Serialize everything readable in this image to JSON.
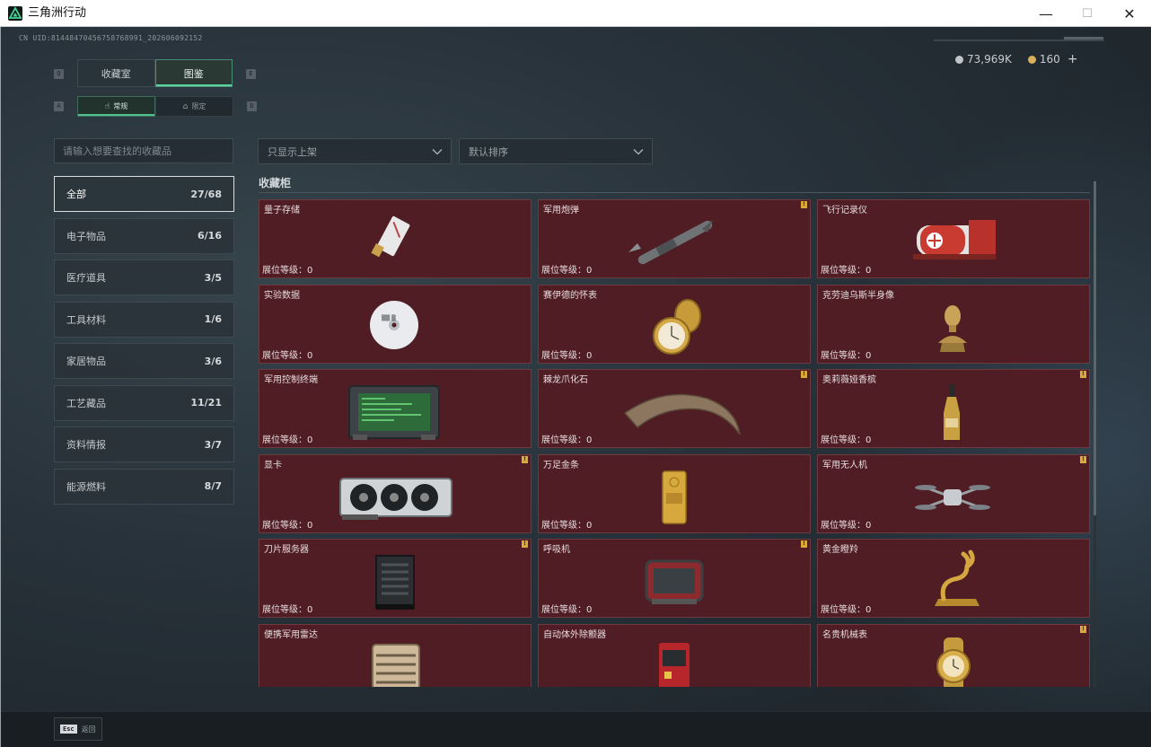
{
  "window": {
    "title": "三角洲行动",
    "minimize": "—",
    "maximize": "☐",
    "close": "✕"
  },
  "uid": "CN UID:81448470456758768991_202606092152",
  "currency": {
    "primary": "73,969K",
    "secondary": "160",
    "add": "+",
    "primary_color": "#c0c6c9",
    "secondary_color": "#d8b25a"
  },
  "hotkeys": {
    "q": "Q",
    "e": "E",
    "a": "A",
    "d": "D"
  },
  "tabs": [
    {
      "label": "收藏室"
    },
    {
      "label": "图鉴"
    }
  ],
  "subtabs": [
    {
      "label": "常规"
    },
    {
      "label": "限定"
    }
  ],
  "search": {
    "placeholder": "请输入想要查找的收藏品"
  },
  "filters": {
    "show_filter": "只显示上架",
    "sort": "默认排序"
  },
  "categories": [
    {
      "label": "全部",
      "count": "27/68"
    },
    {
      "label": "电子物品",
      "count": "6/16"
    },
    {
      "label": "医疗道具",
      "count": "3/5"
    },
    {
      "label": "工具材料",
      "count": "1/6"
    },
    {
      "label": "家居物品",
      "count": "3/6"
    },
    {
      "label": "工艺藏品",
      "count": "11/21"
    },
    {
      "label": "资料情报",
      "count": "3/7"
    },
    {
      "label": "能源燃料",
      "count": "8/7"
    }
  ],
  "section": {
    "title": "收藏柜"
  },
  "level_label": "展位等级：",
  "items": [
    {
      "name": "量子存储",
      "level": "0",
      "flag": false,
      "icon": "usb-drive-icon"
    },
    {
      "name": "军用炮弹",
      "level": "0",
      "flag": true,
      "icon": "missile-icon"
    },
    {
      "name": "飞行记录仪",
      "level": "0",
      "flag": false,
      "icon": "flight-recorder-icon"
    },
    {
      "name": "实验数据",
      "level": "0",
      "flag": false,
      "icon": "disc-icon"
    },
    {
      "name": "赛伊德的怀表",
      "level": "0",
      "flag": false,
      "icon": "pocket-watch-icon"
    },
    {
      "name": "克劳迪乌斯半身像",
      "level": "0",
      "flag": false,
      "icon": "bust-icon"
    },
    {
      "name": "军用控制终端",
      "level": "0",
      "flag": false,
      "icon": "tablet-terminal-icon"
    },
    {
      "name": "棘龙爪化石",
      "level": "0",
      "flag": true,
      "icon": "claw-fossil-icon"
    },
    {
      "name": "奥莉薇娅香槟",
      "level": "0",
      "flag": true,
      "icon": "champagne-icon"
    },
    {
      "name": "显卡",
      "level": "0",
      "flag": true,
      "icon": "graphics-card-icon"
    },
    {
      "name": "万足金条",
      "level": "0",
      "flag": false,
      "icon": "gold-bar-icon"
    },
    {
      "name": "军用无人机",
      "level": "0",
      "flag": true,
      "icon": "drone-icon"
    },
    {
      "name": "刀片服务器",
      "level": "0",
      "flag": true,
      "icon": "blade-server-icon"
    },
    {
      "name": "呼吸机",
      "level": "0",
      "flag": true,
      "icon": "ventilator-icon"
    },
    {
      "name": "黄金瞪羚",
      "level": "0",
      "flag": false,
      "icon": "gold-gazelle-icon"
    },
    {
      "name": "便携军用雷达",
      "level": "",
      "flag": false,
      "icon": "radar-icon"
    },
    {
      "name": "自动体外除颤器",
      "level": "",
      "flag": false,
      "icon": "defibrillator-icon"
    },
    {
      "name": "名贵机械表",
      "level": "",
      "flag": true,
      "icon": "wristwatch-icon"
    }
  ],
  "bottom": {
    "esc_key": "Esc",
    "esc_label": "返回"
  }
}
